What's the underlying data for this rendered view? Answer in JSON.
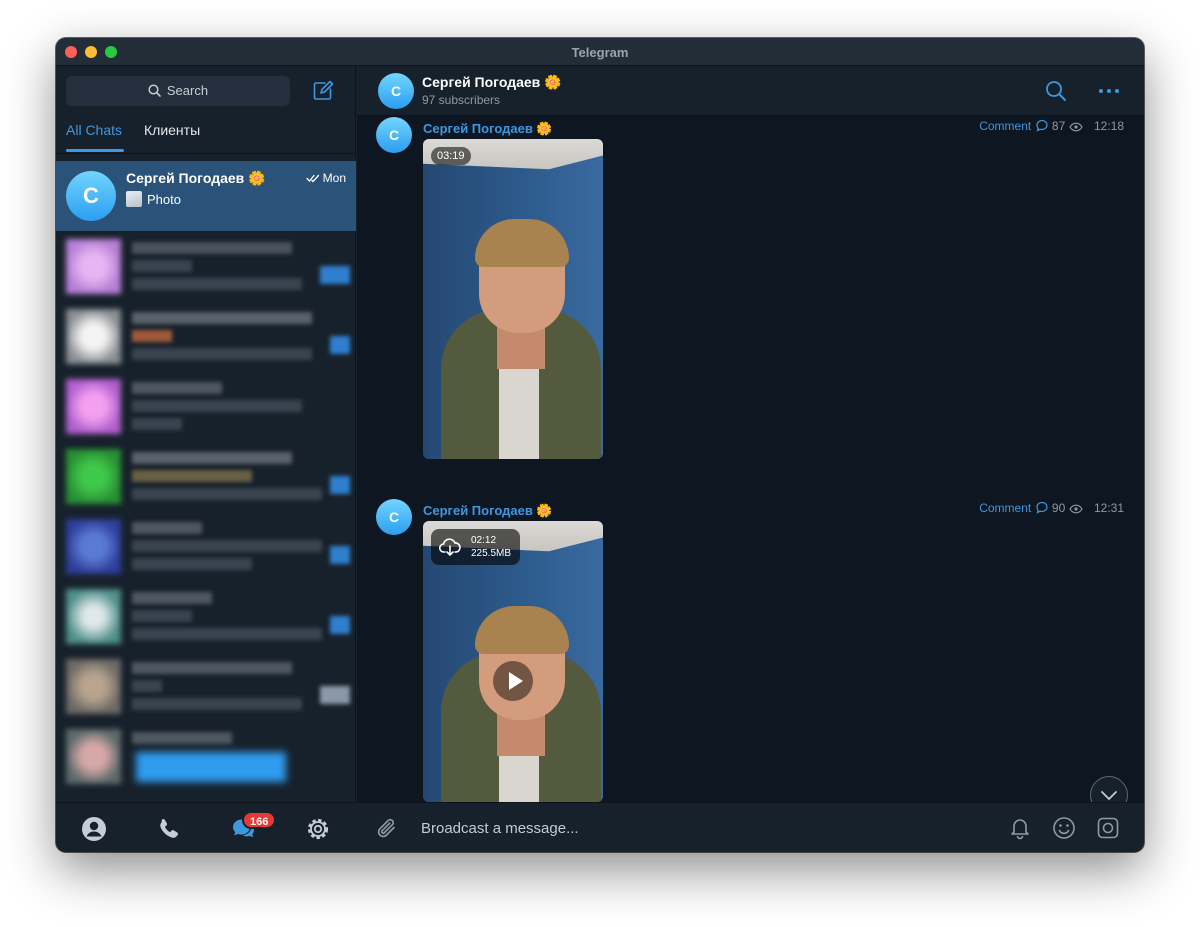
{
  "window": {
    "title": "Telegram"
  },
  "sidebar": {
    "search_label": "Search",
    "tabs": [
      {
        "label": "All Chats"
      },
      {
        "label": "Клиенты"
      }
    ],
    "active_chat": {
      "avatar_letter": "C",
      "name": "Сергей Погодаев 🌼",
      "time": "Mon",
      "preview": "Photo"
    },
    "unread_badge": "166"
  },
  "channel": {
    "avatar_letter": "C",
    "name": "Сергей Погодаев 🌼",
    "subscribers": "97 subscribers"
  },
  "messages": [
    {
      "author": "Сергей Погодаев 🌼",
      "comment_label": "Comment",
      "views": "87",
      "time": "12:18",
      "duration": "03:19"
    },
    {
      "author": "Сергей Погодаев 🌼",
      "comment_label": "Comment",
      "views": "90",
      "time": "12:31",
      "duration": "02:12",
      "size": "225.5MB"
    }
  ],
  "composer": {
    "placeholder": "Broadcast a message..."
  },
  "icons": {
    "search": "search-icon",
    "compose": "compose-icon",
    "contacts": "contacts-icon",
    "calls": "phone-icon",
    "chats": "chats-icon",
    "settings": "gear-icon",
    "channel_search": "search-icon",
    "more": "more-icon",
    "attach": "paperclip-icon",
    "mute": "bell-icon",
    "emoji": "emoji-icon",
    "stickers": "sticker-icon",
    "scroll": "chevron-down-icon"
  },
  "colors": {
    "accent": "#3d98e0",
    "active_chat_bg": "#2b5278",
    "badge": "#e53935",
    "sidebar_bg": "#17212b",
    "chat_bg": "#0e1621"
  }
}
